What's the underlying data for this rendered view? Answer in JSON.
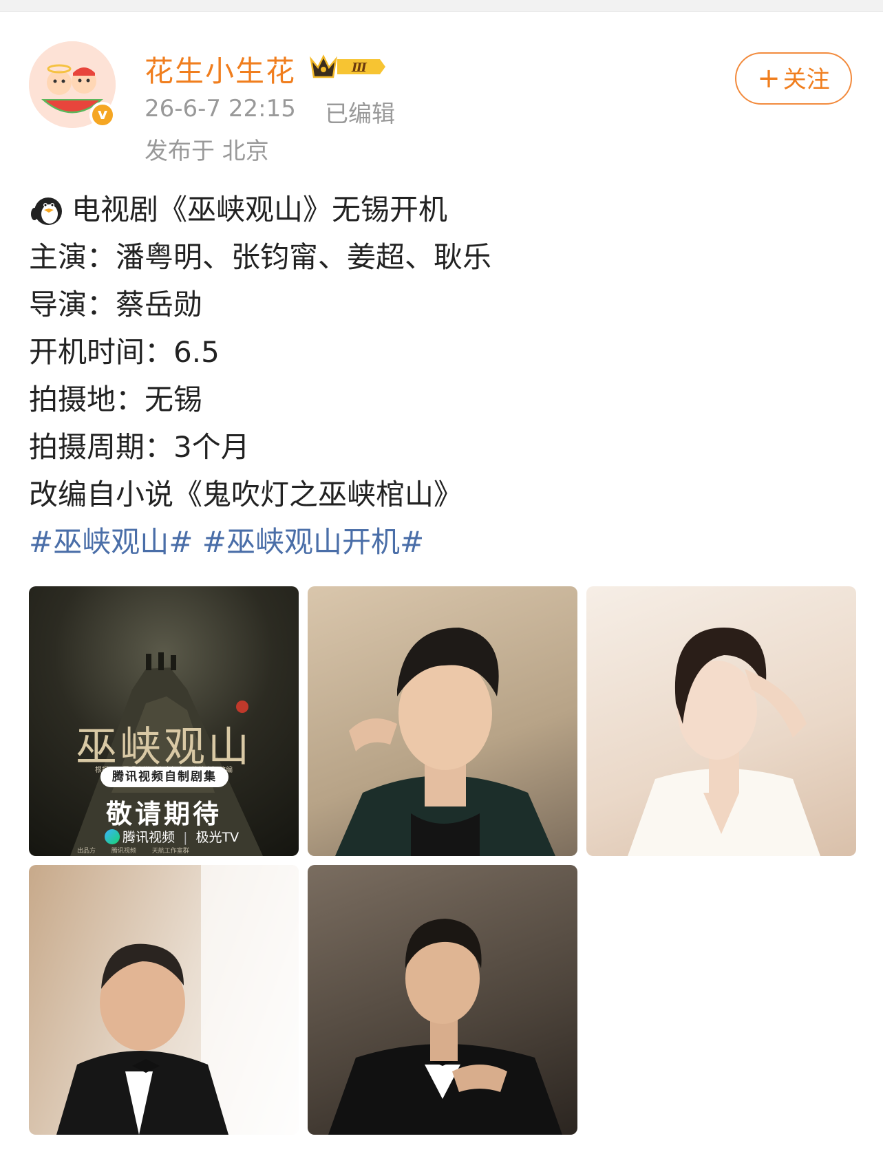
{
  "post": {
    "author": {
      "name": "花生小生花",
      "vip_level": "Ⅲ",
      "verified_mark": "v"
    },
    "timestamp": "26-6-7 22:15",
    "edited": "已编辑",
    "location": "发布于 北京",
    "follow": {
      "plus": "+",
      "label": "关注"
    },
    "lines": [
      "电视剧《巫峡观山》无锡开机",
      "主演：潘粤明、张钧甯、姜超、耿乐",
      "导演：蔡岳勋",
      "开机时间：6.5",
      "拍摄地：无锡",
      "拍摄周期：3个月",
      "改编自小说《鬼吹灯之巫峡棺山》"
    ],
    "hashtags": [
      "#巫峡观山#",
      "#巫峡观山开机#"
    ],
    "lead_emoji": "penguin-icon"
  },
  "poster": {
    "title": "巫峡观山",
    "subtitle": "根据天下霸唱小说《鬼吹灯之巫峡棺山》改编",
    "pill": "腾讯视频自制剧集",
    "cta": "敬请期待",
    "brands": [
      "腾讯视频",
      "极光TV"
    ],
    "footer": [
      "出品方",
      "腾讯视频",
      "天航工作室群"
    ]
  },
  "colors": {
    "username": "#f07e1e",
    "meta": "#999999",
    "text": "#222222",
    "hashtag": "#4a6ea8",
    "follow_border": "#f28a3c"
  }
}
